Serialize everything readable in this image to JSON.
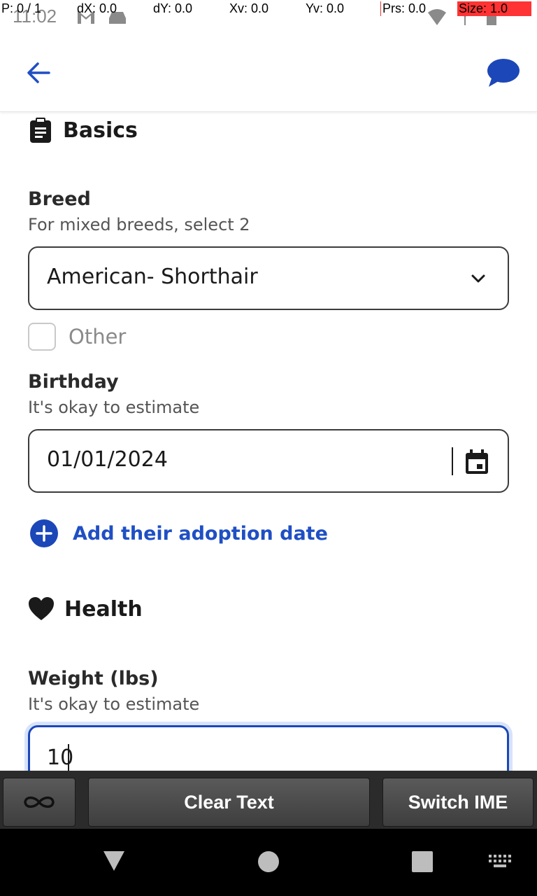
{
  "status_bar": {
    "time": "11:02"
  },
  "overlay": {
    "pointer": "P: 0 / 1",
    "dx": "dX: 0.0",
    "dy": "dY: 0.0",
    "xv": "Xv: 0.0",
    "yv": "Yv: 0.0",
    "prs": "Prs: 0.0",
    "size": "Size: 1.0"
  },
  "app_bar": {
    "accent": "#1f4fc4"
  },
  "basics": {
    "title": "Basics",
    "breed": {
      "label": "Breed",
      "help": "For mixed breeds, select 2",
      "selected": "American- Shorthair"
    },
    "other_checkbox": {
      "label": "Other",
      "checked": false
    },
    "birthday": {
      "label": "Birthday",
      "help": "It's okay to estimate",
      "value": "01/01/2024"
    },
    "add_adoption": "Add their adoption date"
  },
  "health": {
    "title": "Health",
    "weight": {
      "label": "Weight (lbs)",
      "help": "It's okay to estimate",
      "value": "10"
    }
  },
  "keyboard_bar": {
    "clear_text": "Clear Text",
    "switch_ime": "Switch IME"
  }
}
